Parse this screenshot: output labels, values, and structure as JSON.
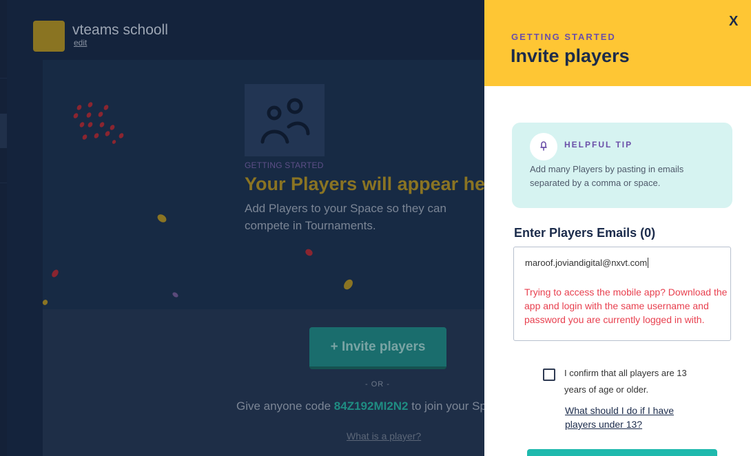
{
  "header": {
    "space_name": "vteams schooll",
    "edit_label": "edit"
  },
  "empty_state": {
    "eyebrow": "GETTING STARTED",
    "title": "Your Players will appear here",
    "description": "Add Players to your Space so they can compete in Tournaments.",
    "invite_button": "+ Invite players",
    "or_label": "- OR -",
    "code_prefix": "Give anyone code",
    "code": "84Z192MI2N2",
    "code_suffix": "to join your Space",
    "help_link": "What is a player?"
  },
  "drawer": {
    "close_label": "X",
    "eyebrow": "GETTING STARTED",
    "title": "Invite players",
    "tip": {
      "label": "HELPFUL TIP",
      "text": "Add many Players by pasting in emails separated by a comma or space."
    },
    "emails_label": "Enter Players Emails (0)",
    "emails_value": "maroof.joviandigital@nxvt.com",
    "mobile_note": "Trying to access the mobile app? Download the app and login with the same username and password you are currently logged in with.",
    "age_confirm": "I confirm that all players are 13 years of age or older.",
    "under13_link": "What should I do if I have players under 13?"
  },
  "colors": {
    "accent_yellow": "#fec634",
    "teal": "#1fb9ad",
    "purple": "#6b4fa8",
    "navy": "#1b2b4b",
    "error": "#e8404f",
    "tip_bg": "#d6f3f1"
  },
  "icons": [
    "players-icon",
    "lightbulb-icon",
    "close-icon"
  ]
}
